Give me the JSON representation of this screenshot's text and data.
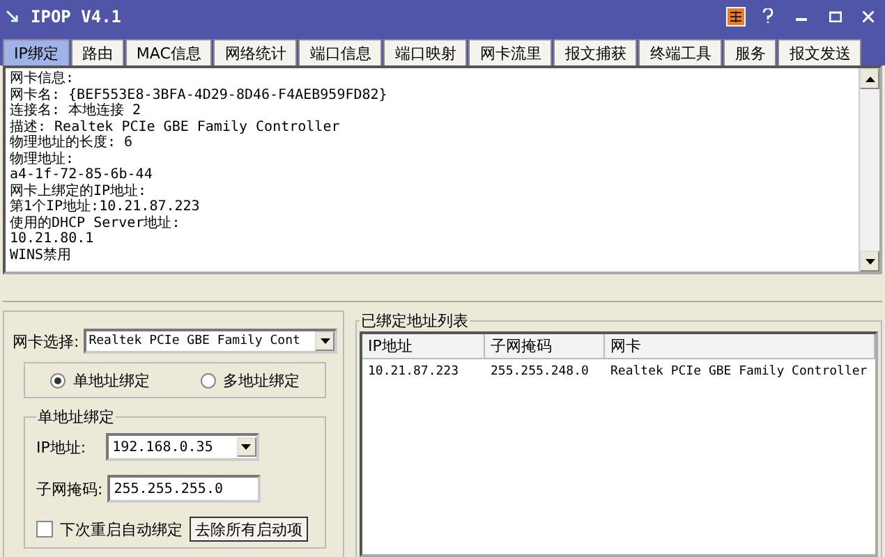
{
  "window": {
    "title": "IPOP V4.1"
  },
  "tabs": [
    {
      "label": "IP绑定",
      "selected": true
    },
    {
      "label": "路由",
      "selected": false
    },
    {
      "label": "MAC信息",
      "selected": false
    },
    {
      "label": "网络统计",
      "selected": false
    },
    {
      "label": "端口信息",
      "selected": false
    },
    {
      "label": "端口映射",
      "selected": false
    },
    {
      "label": "网卡流里",
      "selected": false
    },
    {
      "label": "报文捕获",
      "selected": false
    },
    {
      "label": "终端工具",
      "selected": false
    },
    {
      "label": "服务",
      "selected": false
    },
    {
      "label": "报文发送",
      "selected": false
    }
  ],
  "info_lines": [
    "网卡信息:",
    "网卡名: {BEF553E8-3BFA-4D29-8D46-F4AEB959FD82}",
    "连接名: 本地连接 2",
    "描述: Realtek PCIe GBE Family Controller",
    "物理地址的长度: 6",
    "物理地址:",
    "a4-1f-72-85-6b-44",
    "网卡上绑定的IP地址:",
    "第1个IP地址:10.21.87.223",
    "使用的DHCP Server地址:",
    "10.21.80.1",
    "WINS禁用"
  ],
  "adapter_select": {
    "label": "网卡选择:",
    "value": "Realtek PCIe GBE Family Cont"
  },
  "bind_modes": [
    {
      "label": "单地址绑定",
      "selected": true
    },
    {
      "label": "多地址绑定",
      "selected": false
    }
  ],
  "single_binding": {
    "title": "单地址绑定",
    "ip_label": "IP地址:",
    "ip_value": "192.168.0.35",
    "mask_label": "子网掩码:",
    "mask_value": "255.255.255.0",
    "auto_bind": {
      "label": "下次重启自动绑定",
      "checked": false
    },
    "clear_button": "去除所有启动项"
  },
  "bound_list": {
    "title": "已绑定地址列表",
    "columns": [
      "IP地址",
      "子网掩码",
      "网卡"
    ],
    "rows": [
      [
        "10.21.87.223",
        "255.255.248.0",
        "Realtek PCIe GBE Family Controller"
      ]
    ]
  }
}
